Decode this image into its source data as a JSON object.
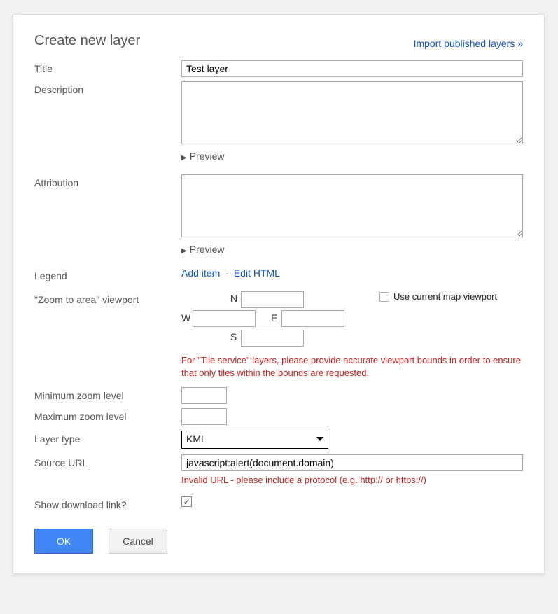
{
  "dialog": {
    "title": "Create new layer",
    "import_link": "Import published layers »"
  },
  "fields": {
    "title_label": "Title",
    "title_value": "Test layer",
    "description_label": "Description",
    "description_value": "",
    "attribution_label": "Attribution",
    "attribution_value": "",
    "preview_label": "Preview",
    "legend_label": "Legend",
    "legend_add": "Add item",
    "legend_edit": "Edit HTML",
    "viewport_label": "\"Zoom to area\" viewport",
    "viewport": {
      "n_label": "N",
      "n_value": "",
      "w_label": "W",
      "w_value": "",
      "e_label": "E",
      "e_value": "",
      "s_label": "S",
      "s_value": ""
    },
    "use_current_label": "Use current map viewport",
    "viewport_hint": "For \"Tile service\" layers, please provide accurate viewport bounds in order to ensure that only tiles within the bounds are requested.",
    "min_zoom_label": "Minimum zoom level",
    "min_zoom_value": "",
    "max_zoom_label": "Maximum zoom level",
    "max_zoom_value": "",
    "layer_type_label": "Layer type",
    "layer_type_value": "KML",
    "source_url_label": "Source URL",
    "source_url_value": "javascript:alert(document.domain)",
    "source_url_error": "Invalid URL - please include a protocol (e.g. http:// or https://)",
    "download_label": "Show download link?",
    "download_checked": true
  },
  "buttons": {
    "ok": "OK",
    "cancel": "Cancel"
  }
}
